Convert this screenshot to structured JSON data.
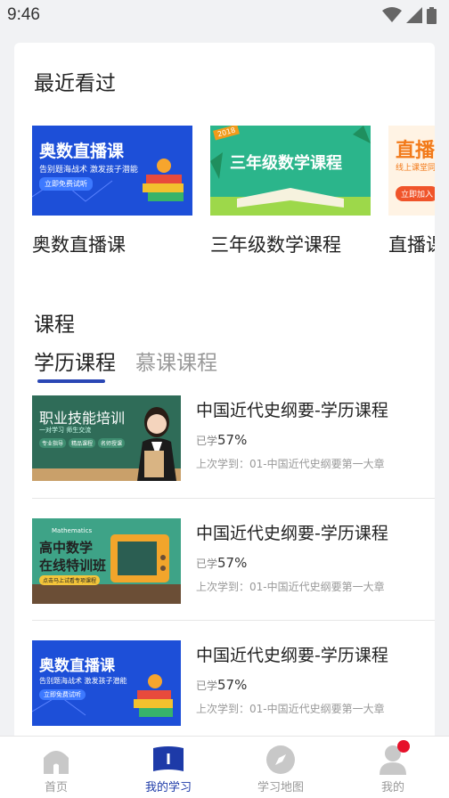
{
  "status_bar": {
    "time": "9:46"
  },
  "recent": {
    "title": "最近看过",
    "items": [
      {
        "label": "奥数直播课",
        "thumb_title": "奥数直播课",
        "thumb_sub": "告别题海战术 激发孩子潜能",
        "thumb_btn": "立即免费试听"
      },
      {
        "label": "三年级数学课程",
        "thumb_title": "三年级数学课程",
        "thumb_badge": "2018"
      },
      {
        "label": "直播课",
        "thumb_title": "直播",
        "thumb_sub": "线上课堂同",
        "thumb_btn": "立即加入"
      }
    ]
  },
  "courses": {
    "title": "课程",
    "tabs": [
      {
        "label": "学历课程",
        "active": true
      },
      {
        "label": "慕课课程",
        "active": false
      }
    ],
    "items": [
      {
        "title": "中国近代史纲要-学历课程",
        "progress_label": "已学",
        "progress": "57%",
        "last_study": "上次学到：01-中国近代史纲要第一大章",
        "thumb_title": "职业技能培训",
        "thumb_sub": "一对学习 师生交流",
        "thumb_tags": [
          "专业指导",
          "精品课程",
          "名师授课"
        ]
      },
      {
        "title": "中国近代史纲要-学历课程",
        "progress_label": "已学",
        "progress": "57%",
        "last_study": "上次学到：01-中国近代史纲要第一大章",
        "thumb_title": "高中数学",
        "thumb_title2": "在线特训班",
        "thumb_tag": "Mathematics",
        "thumb_btn": "点击马上试看专项课程"
      },
      {
        "title": "中国近代史纲要-学历课程",
        "progress_label": "已学",
        "progress": "57%",
        "last_study": "上次学到：01-中国近代史纲要第一大章",
        "thumb_title": "奥数直播课",
        "thumb_sub": "告别题海战术 激发孩子潜能",
        "thumb_btn": "立即免费试听"
      }
    ]
  },
  "tabbar": {
    "items": [
      {
        "label": "首页",
        "icon": "home-icon",
        "active": false
      },
      {
        "label": "我的学习",
        "icon": "book-icon",
        "active": true
      },
      {
        "label": "学习地图",
        "icon": "compass-icon",
        "active": false
      },
      {
        "label": "我的",
        "icon": "user-icon",
        "active": false,
        "badge": true
      }
    ]
  },
  "colors": {
    "accent": "#1d3aa8",
    "badge": "#e6112a",
    "background": "#f1f2f4"
  }
}
